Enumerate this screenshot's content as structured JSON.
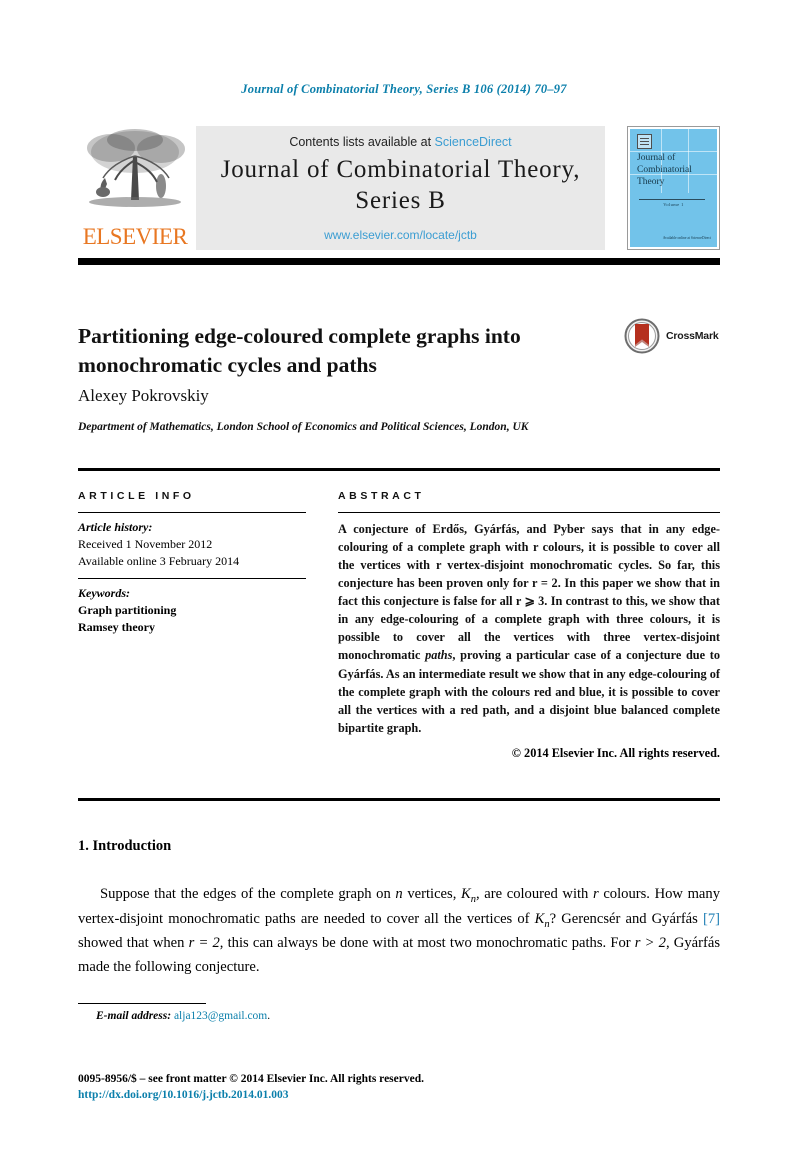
{
  "running_head": "Journal of Combinatorial Theory, Series B 106 (2014) 70–97",
  "header": {
    "publisher_wordmark": "ELSEVIER",
    "contents_prefix": "Contents lists available at ",
    "contents_link": "ScienceDirect",
    "journal_title_line1": "Journal of Combinatorial Theory,",
    "journal_title_line2": "Series B",
    "journal_url": "www.elsevier.com/locate/jctb",
    "cover": {
      "title_line1": "Journal of",
      "title_line2": "Combinatorial",
      "title_line3": "Theory",
      "volume_text": "Volume 1",
      "footer_text": "Available online at\nScienceDirect"
    }
  },
  "article": {
    "title": "Partitioning edge-coloured complete graphs into monochromatic cycles and paths",
    "crossmark_label": "CrossMark",
    "author": "Alexey Pokrovskiy",
    "affiliation": "Department of Mathematics, London School of Economics and Political Sciences, London, UK"
  },
  "article_info": {
    "heading": "ARTICLE INFO",
    "history_label": "Article history:",
    "history_lines": [
      "Received 1 November 2012",
      "Available online 3 February 2014"
    ],
    "keywords_label": "Keywords:",
    "keywords": [
      "Graph partitioning",
      "Ramsey theory"
    ]
  },
  "abstract": {
    "heading": "ABSTRACT",
    "text_before_italic": "A conjecture of Erdős, Gyárfás, and Pyber says that in any edge-colouring of a complete graph with r colours, it is possible to cover all the vertices with r vertex-disjoint monochromatic cycles. So far, this conjecture has been proven only for r = 2. In this paper we show that in fact this conjecture is false for all r ⩾ 3. In contrast to this, we show that in any edge-colouring of a complete graph with three colours, it is possible to cover all the vertices with three vertex-disjoint monochromatic ",
    "italic_word": "paths",
    "text_after_italic": ", proving a particular case of a conjecture due to Gyárfás. As an intermediate result we show that in any edge-colouring of the complete graph with the colours red and blue, it is possible to cover all the vertices with a red path, and a disjoint blue balanced complete bipartite graph.",
    "copyright": "© 2014 Elsevier Inc. All rights reserved."
  },
  "body": {
    "section_heading": "1. Introduction",
    "paragraph_parts": {
      "p1": "Suppose that the edges of the complete graph on ",
      "n": "n",
      "p2": " vertices, ",
      "kn": "K",
      "kn_sub": "n",
      "p3": ", are coloured with ",
      "r1": "r",
      "p4": " colours. How many vertex-disjoint monochromatic paths are needed to cover all the vertices of ",
      "kn2": "K",
      "kn2_sub": "n",
      "p5": "? Gerencsér and Gyárfás ",
      "ref": "[7]",
      "p6": " showed that when ",
      "req2": "r = 2",
      "p7": ", this can always be done with at most two monochromatic paths. For ",
      "rgt2": "r > 2",
      "p8": ", Gyárfás made the following conjecture."
    }
  },
  "footnote": {
    "label": "E-mail address:",
    "email": "alja123@gmail.com",
    "trailing": "."
  },
  "footer": {
    "issn_line": "0095-8956/$ – see front matter  © 2014 Elsevier Inc. All rights reserved.",
    "doi_line": "http://dx.doi.org/10.1016/j.jctb.2014.01.003"
  },
  "colors": {
    "link_blue": "#0b7fab",
    "science_direct_blue": "#3b9dd2",
    "elsevier_orange": "#e87722",
    "cover_blue": "#72c3ea",
    "crossmark_red": "#b5301e",
    "band_grey": "#e9e9e9"
  }
}
